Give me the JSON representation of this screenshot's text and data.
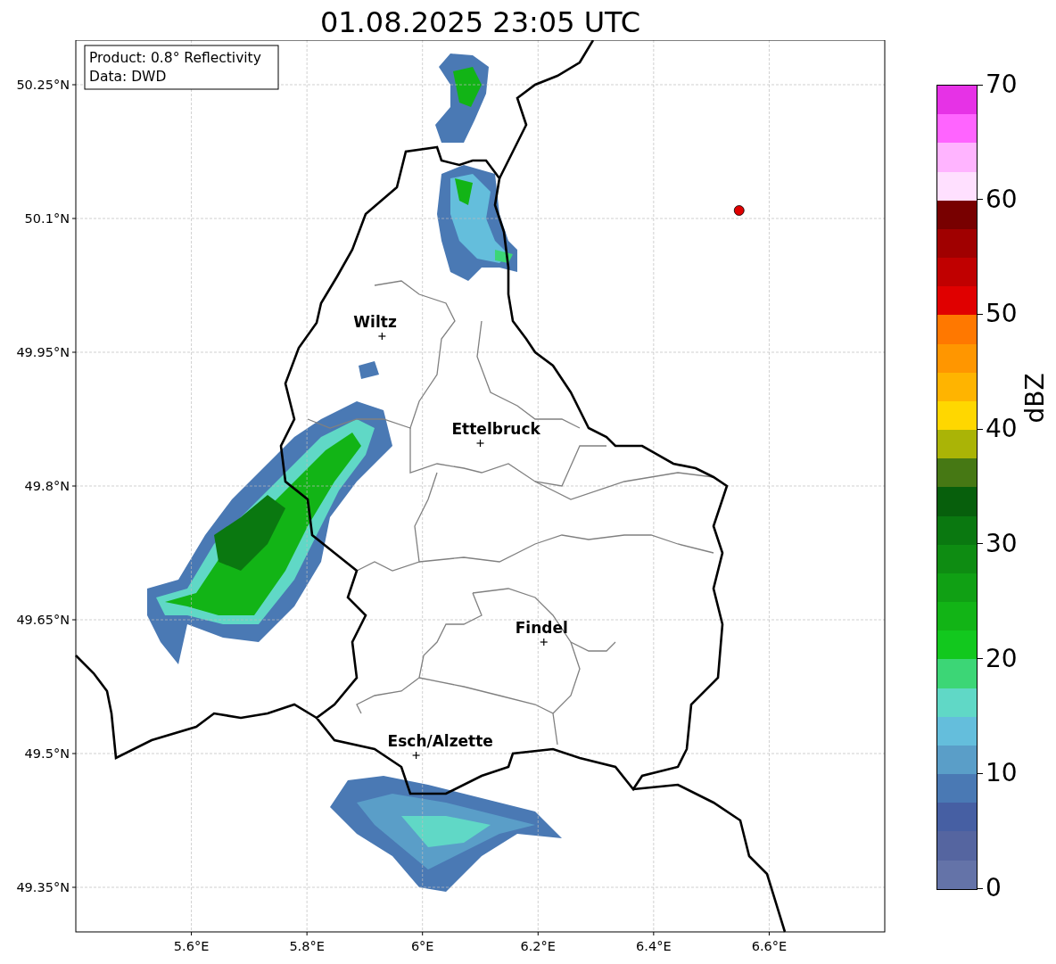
{
  "title": "01.08.2025 23:05 UTC",
  "map": {
    "info_box": [
      "Product: 0.8° Reflectivity",
      "Data: DWD"
    ],
    "lon_labels": [
      "5.6°E",
      "5.8°E",
      "6°E",
      "6.2°E",
      "6.4°E",
      "6.6°E"
    ],
    "lat_labels": [
      "50.25°N",
      "50.1°N",
      "49.95°N",
      "49.8°N",
      "49.65°N",
      "49.5°N",
      "49.35°N"
    ],
    "cities": [
      {
        "name": "Wiltz"
      },
      {
        "name": "Ettelbruck"
      },
      {
        "name": "Findel"
      },
      {
        "name": "Esch/Alzette"
      }
    ],
    "radar_site": {
      "color": "#e00000"
    }
  },
  "colorbar": {
    "label": "dBZ",
    "ticks": [
      "70",
      "60",
      "50",
      "40",
      "30",
      "20",
      "10",
      "0"
    ],
    "bins": [
      {
        "color": "#e632e6"
      },
      {
        "color": "#ff64ff"
      },
      {
        "color": "#ffb4ff"
      },
      {
        "color": "#ffe0ff"
      },
      {
        "color": "#780000"
      },
      {
        "color": "#a00000"
      },
      {
        "color": "#c00000"
      },
      {
        "color": "#e00000"
      },
      {
        "color": "#ff7800"
      },
      {
        "color": "#ff9600"
      },
      {
        "color": "#ffb400"
      },
      {
        "color": "#ffd700"
      },
      {
        "color": "#aab406"
      },
      {
        "color": "#467814"
      },
      {
        "color": "#075f0c"
      },
      {
        "color": "#0a7810"
      },
      {
        "color": "#0e8c12"
      },
      {
        "color": "#10a014"
      },
      {
        "color": "#12b416"
      },
      {
        "color": "#12c81e"
      },
      {
        "color": "#3cd676"
      },
      {
        "color": "#60d8c6"
      },
      {
        "color": "#64bedc"
      },
      {
        "color": "#5a9ec8"
      },
      {
        "color": "#4a79b4"
      },
      {
        "color": "#465fa3"
      },
      {
        "color": "#5565a0"
      },
      {
        "color": "#6473a8"
      }
    ]
  }
}
